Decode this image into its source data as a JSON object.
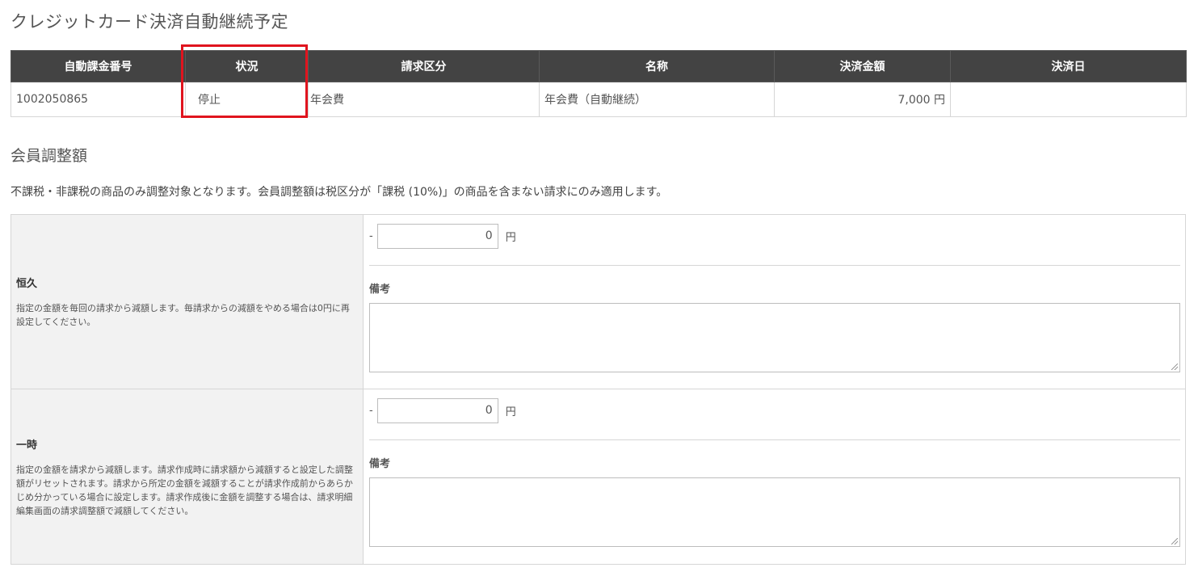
{
  "page": {
    "title": "クレジットカード決済自動継続予定"
  },
  "schedule_table": {
    "headers": [
      "自動課金番号",
      "状況",
      "請求区分",
      "名称",
      "決済金額",
      "決済日"
    ],
    "row": {
      "billing_number": "1002050865",
      "status": "停止",
      "category": "年会費",
      "name": "年会費（自動継続）",
      "amount": "7,000 円",
      "date": ""
    },
    "highlight_color": "#e0141e"
  },
  "adjustment": {
    "section_title": "会員調整額",
    "note": "不課税・非課税の商品のみ調整対象となります。会員調整額は税区分が「課税 (10%)」の商品を含まない請求にのみ適用します。",
    "permanent": {
      "label": "恒久",
      "description": "指定の金額を毎回の請求から減額します。毎請求からの減額をやめる場合は0円に再設定してください。",
      "minus": "-",
      "amount": "0",
      "unit": "円",
      "remark_label": "備考",
      "remark_value": ""
    },
    "temporary": {
      "label": "一時",
      "description": "指定の金額を請求から減額します。請求作成時に請求額から減額すると設定した調整額がリセットされます。請求から所定の金額を減額することが請求作成前からあらかじめ分かっている場合に設定します。請求作成後に金額を調整する場合は、請求明細編集画面の請求調整額で減額してください。",
      "minus": "-",
      "amount": "0",
      "unit": "円",
      "remark_label": "備考",
      "remark_value": ""
    }
  },
  "colors": {
    "header_bg": "#434343",
    "label_bg": "#f2f2f2"
  }
}
